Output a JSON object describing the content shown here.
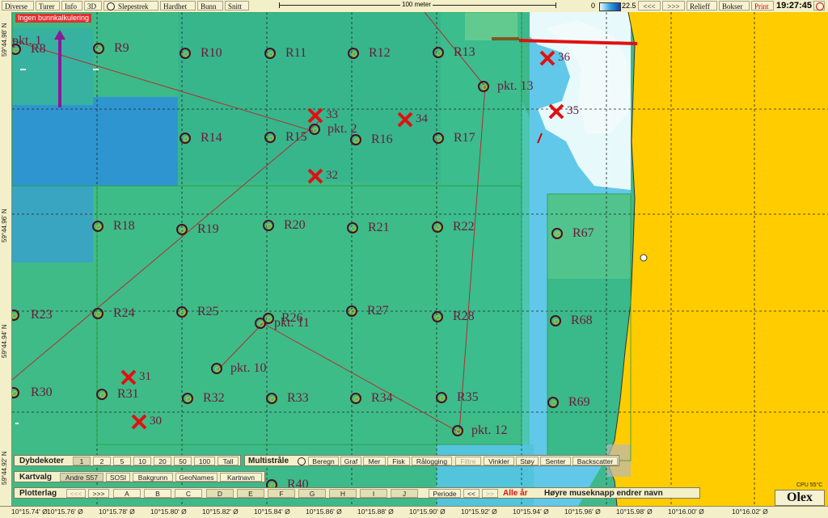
{
  "menu": [
    "Diverse",
    "Turer",
    "Info",
    "3D",
    "Slepestrek",
    "Hardhet",
    "Bunn",
    "Snitt"
  ],
  "scale_bar": "100 meter",
  "depth_legend": {
    "min": "0",
    "max": "22.5"
  },
  "nav": {
    "back": "<<<",
    "forward": ">>>"
  },
  "toolbar_right": {
    "relief": "Relieff",
    "boxes": "Bokser",
    "print": "Print"
  },
  "clock": "19:27:45",
  "warning": "Ingen bunnkalkulering",
  "cpu": "CPU 55°C",
  "logo": "Olex",
  "lat_ticks": [
    "59°44.98' N",
    "59°44.96' N",
    "59°44.94' N",
    "59°44.92' N"
  ],
  "lon_ticks": [
    "10°15.74' Ø",
    "10°15.76' Ø",
    "10°15.78' Ø",
    "10°15.80' Ø",
    "10°15.82' Ø",
    "10°15.84' Ø",
    "10°15.86' Ø",
    "10°15.88' Ø",
    "10°15.90' Ø",
    "10°15.92' Ø",
    "10°15.94' Ø",
    "10°15.96' Ø",
    "10°15.98' Ø",
    "10°16.00' Ø",
    "10°16.02' Ø"
  ],
  "markers": {
    "R8": "R8",
    "R9": "R9",
    "R10": "R10",
    "R11": "R11",
    "R12": "R12",
    "R13": "R13",
    "R14": "R14",
    "R15": "R15",
    "R16": "R16",
    "R17": "R17",
    "R18": "R18",
    "R19": "R19",
    "R20": "R20",
    "R21": "R21",
    "R22": "R22",
    "R67": "R67",
    "R23": "R23",
    "R24": "R24",
    "R25": "R25",
    "R26": "R26",
    "R27": "R27",
    "R28": "R28",
    "R68": "R68",
    "R30": "R30",
    "R31": "R31",
    "R32": "R32",
    "R33": "R33",
    "R34": "R34",
    "R35": "R35",
    "R69": "R69",
    "R40": "R40",
    "pkt1": "pkt. 1",
    "pkt2": "pkt. 2",
    "pkt10": "pkt. 10",
    "pkt11": "pkt. 11",
    "pkt12": "pkt. 12",
    "pkt13": "pkt. 13"
  },
  "crosses": {
    "c30": "30",
    "c31": "31",
    "c32": "32",
    "c33": "33",
    "c34": "34",
    "c35": "35",
    "c36": "36"
  },
  "dybdekoter": {
    "label": "Dybdekoter",
    "values": [
      "1",
      "2",
      "5",
      "10",
      "20",
      "50",
      "100",
      "Tall"
    ]
  },
  "multistraale": {
    "label": "Multistråle",
    "buttons": [
      "Beregn",
      "Graf",
      "Mer",
      "Fisk",
      "Rålogging",
      "Filtre",
      "Vinkler",
      "Støy",
      "Senter",
      "Backscatter"
    ]
  },
  "kartvalg": {
    "label": "Kartvalg",
    "buttons": [
      "Andre S57",
      "SOSI",
      "Bakgrunn",
      "GeoNames",
      "Kartnavn"
    ]
  },
  "plotterlag": {
    "label": "Plotterlag",
    "prev": "<<<",
    "next": ">>>",
    "layers": [
      "A",
      "B",
      "C",
      "D",
      "E",
      "F",
      "G",
      "H",
      "I",
      "J"
    ],
    "periode": "Periode",
    "periode_back": "<<",
    "periode_fwd": ">>",
    "all_years": "Alle år",
    "hint": "Høyre museknapp endrer navn"
  }
}
